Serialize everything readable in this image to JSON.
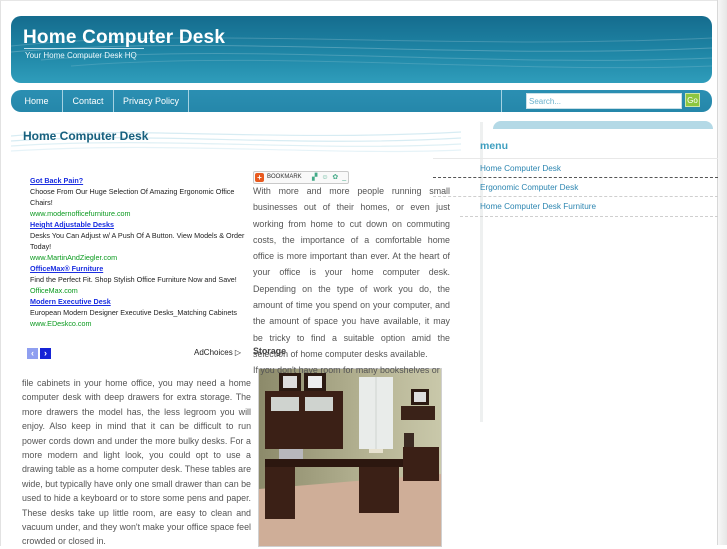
{
  "header": {
    "site_title": "Home Computer Desk",
    "tagline": "Your Home Computer Desk HQ"
  },
  "nav": {
    "items": [
      {
        "label": "Home"
      },
      {
        "label": "Contact"
      },
      {
        "label": "Privacy Policy"
      }
    ],
    "search": {
      "placeholder": "Search...",
      "go_label": "Go"
    }
  },
  "content": {
    "title": "Home Computer Desk",
    "bookmark_label": "BOOKMARK",
    "intro": "With more and more people running small businesses out of their homes, or even just working from home to cut down on commuting costs, the importance of a comfortable home office is more important than ever. At the heart of your office is your home computer desk. Depending on the type of work you do, the amount of time you spend on your computer, and the amount of space you have available, it may be tricky to find a suitable option amid the selection of home computer desks available.",
    "storage_heading": "Storage",
    "storage_first_line": "If you don't have room for many bookshelves or",
    "storage_body": "file cabinets in your home office, you may need a home computer desk with deep drawers for extra storage. The more drawers the model has, the less legroom you will enjoy. Also keep in mind that it can be difficult to run power cords down and under the more bulky desks. For a more modern and light look, you could opt to use a drawing table as a home computer desk. These tables are wide, but typically have only one small drawer than can be used to hide a keyboard or to store some pens and paper. These desks take up little room, are easy to clean and vacuum under, and they won't make your office space feel crowded or closed in.",
    "image_alt": "L-shaped home computer desk with hutch"
  },
  "ads": {
    "items": [
      {
        "title": "Got Back Pain?",
        "desc": "Choose From Our Huge Selection Of Amazing Ergonomic Office Chairs!",
        "url": "www.modernofficefurniture.com"
      },
      {
        "title": "Height Adjustable Desks",
        "desc": "Desks You Can Adjust w/ A Push Of A Button. View Models & Order Today!",
        "url": "www.MartinAndZiegler.com"
      },
      {
        "title": "OfficeMax® Furniture",
        "desc": "Find the Perfect Fit. Shop Stylish Office Furniture Now and Save!",
        "url": "OfficeMax.com"
      },
      {
        "title": "Modern Executive Desk",
        "desc": "European Modern Designer Executive Desks_Matching Cabinets",
        "url": "www.EDeskco.com"
      }
    ],
    "prev_icon": "‹",
    "next_icon": "›",
    "adchoices_label": "AdChoices ▷"
  },
  "sidebar": {
    "heading": "menu",
    "items": [
      {
        "label": "Home Computer Desk"
      },
      {
        "label": "Ergonomic Computer Desk"
      },
      {
        "label": "Home Computer Desk Furniture"
      }
    ]
  },
  "colors": {
    "header_dark": "#156c8e",
    "header_light": "#2f9dbb",
    "nav": "#2587aa",
    "go_button": "#8dc63f",
    "title": "#17607e",
    "menu_link": "#2d86b1",
    "ad_title": "#1a2ee0",
    "ad_url": "#0a9a1e"
  }
}
